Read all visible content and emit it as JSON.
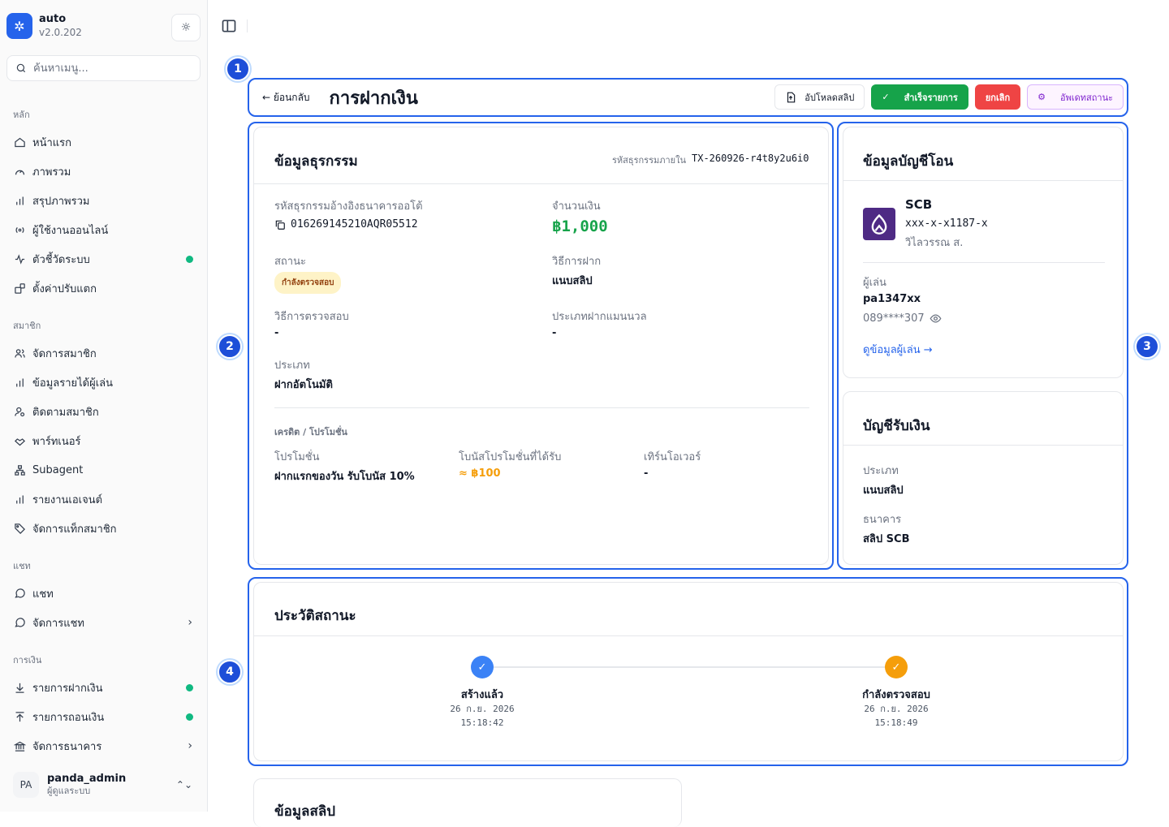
{
  "app": {
    "name": "auto",
    "version": "v2.0.202"
  },
  "search": {
    "placeholder": "ค้นหาเมนู..."
  },
  "sidebar": {
    "sections": [
      {
        "label": "หลัก",
        "items": [
          {
            "label": "หน้าแรก",
            "icon": "home-icon"
          },
          {
            "label": "ภาพรวม",
            "icon": "gauge-icon"
          },
          {
            "label": "สรุปภาพรวม",
            "icon": "bar-chart-icon"
          },
          {
            "label": "ผู้ใช้งานออนไลน์",
            "icon": "broadcast-icon"
          },
          {
            "label": "ตัวชี้วัดระบบ",
            "icon": "activity-icon",
            "dot": true
          },
          {
            "label": "ตั้งค่าปรับแตก",
            "icon": "boxes-icon"
          }
        ]
      },
      {
        "label": "สมาชิก",
        "items": [
          {
            "label": "จัดการสมาชิก",
            "icon": "users-icon"
          },
          {
            "label": "ข้อมูลรายได้ผู้เล่น",
            "icon": "bar-chart-icon"
          },
          {
            "label": "ติดตามสมาชิก",
            "icon": "user-search-icon"
          },
          {
            "label": "พาร์ทเนอร์",
            "icon": "handshake-icon"
          },
          {
            "label": "Subagent",
            "icon": "network-icon"
          },
          {
            "label": "รายงานเอเจนต์",
            "icon": "bar-chart-icon"
          },
          {
            "label": "จัดการแท็กสมาชิก",
            "icon": "tag-icon"
          }
        ]
      },
      {
        "label": "แชท",
        "items": [
          {
            "label": "แชท",
            "icon": "chat-icon"
          },
          {
            "label": "จัดการแชท",
            "icon": "chat-icon",
            "chevron": true
          }
        ]
      },
      {
        "label": "การเงิน",
        "items": [
          {
            "label": "รายการฝากเงิน",
            "icon": "download-icon",
            "dot": true
          },
          {
            "label": "รายการถอนเงิน",
            "icon": "upload-icon",
            "dot": true
          },
          {
            "label": "จัดการธนาคาร",
            "icon": "bank-icon",
            "chevron": true
          }
        ]
      }
    ]
  },
  "user": {
    "initials": "PA",
    "name": "panda_admin",
    "role": "ผู้ดูแลระบบ"
  },
  "markers": [
    "1",
    "2",
    "3",
    "4"
  ],
  "header": {
    "back": "← ย้อนกลับ",
    "title": "การฝากเงิน",
    "actions": {
      "upload": "อัปโหลดสลิป",
      "complete": "สำเร็จรายการ",
      "cancel": "ยกเลิก",
      "update": "อัพเดทสถานะ"
    }
  },
  "transaction": {
    "title": "ข้อมูลธุรกรรม",
    "internal_id_label": "รหัสธุรกรรมภายใน",
    "internal_id": "TX-260926-r4t8y2u6i0",
    "bank_ref_label": "รหัสธุรกรรมอ้างอิงธนาคารออโต้",
    "bank_ref": "016269145210AQR05512",
    "amount_label": "จำนวนเงิน",
    "amount": "฿1,000",
    "status_label": "สถานะ",
    "status": "กำลังตรวจสอบ",
    "method_label": "วิธีการฝาก",
    "method": "แนบสลิป",
    "verify_label": "วิธีการตรวจสอบ",
    "verify": "-",
    "manual_type_label": "ประเภทฝากแมนนวล",
    "manual_type": "-",
    "type_label": "ประเภท",
    "type": "ฝากอัตโนมัติ",
    "credit_section": "เครดิต / โปรโมชั่น",
    "promo_label": "โปรโมชั่น",
    "promo": "ฝากแรกของวัน รับโบนัส 10%",
    "bonus_label": "โบนัสโปรโมชั่นที่ได้รับ",
    "bonus": "≈ ฿100",
    "turnover_label": "เทิร์นโอเวอร์",
    "turnover": "-"
  },
  "sender": {
    "title": "ข้อมูลบัญชีโอน",
    "bank": "SCB",
    "account": "xxx-x-x1187-x",
    "holder": "วิไลวรรณ ส.",
    "player_label": "ผู้เล่น",
    "player": "pa1347xx",
    "phone": "089****307",
    "view_link": "ดูข้อมูลผู้เล่น →",
    "bank_color": "#4e2a84"
  },
  "receiver": {
    "title": "บัญชีรับเงิน",
    "type_label": "ประเภท",
    "type": "แนบสลิป",
    "bank_label": "ธนาคาร",
    "bank": "สลิป SCB"
  },
  "history": {
    "title": "ประวัติสถานะ",
    "steps": [
      {
        "label": "สร้างแล้ว",
        "date": "26 ก.ย. 2026",
        "time": "15:18:42",
        "color": "#3b82f6"
      },
      {
        "label": "กำลังตรวจสอบ",
        "date": "26 ก.ย. 2026",
        "time": "15:18:49",
        "color": "#f59e0b"
      }
    ]
  },
  "slip": {
    "title": "ข้อมูลสลิป"
  }
}
